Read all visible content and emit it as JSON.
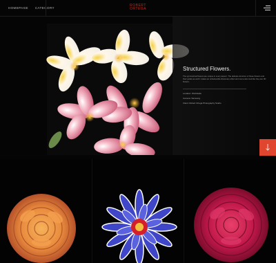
{
  "header": {
    "nav": [
      {
        "label": "HOMEPAGE"
      },
      {
        "label": "CATEGORY"
      }
    ],
    "logo_line1": "ROBERT",
    "logo_line2": "ORTEGA",
    "menu_icon": "hamburger-menu-icon"
  },
  "hero": {
    "title": "Structured Flowers.",
    "description": "The symmetrical flowers are unique in every aspect. The delicate structure of these flowers and their petals as well it makes an unbelievable illusionary effect and some also look like they are 3D flowers.",
    "meta": [
      "Location: Worldwide",
      "Camera: Samsung",
      "Client: Robert Ortega Photography Studio"
    ],
    "image_icon": "plumeria-flowers-photo"
  },
  "scroll_button": {
    "icon": "arrow-down-icon",
    "color": "#e0452d"
  },
  "gallery": [
    {
      "icon": "orange-rose-photo",
      "color": "#e98a3d"
    },
    {
      "icon": "blue-dahlia-photo",
      "color": "#3f46c8"
    },
    {
      "icon": "magenta-rose-photo",
      "color": "#c1184a"
    }
  ],
  "colors": {
    "background": "#050505",
    "accent": "#e0452d",
    "logo": "#c02b1e"
  }
}
